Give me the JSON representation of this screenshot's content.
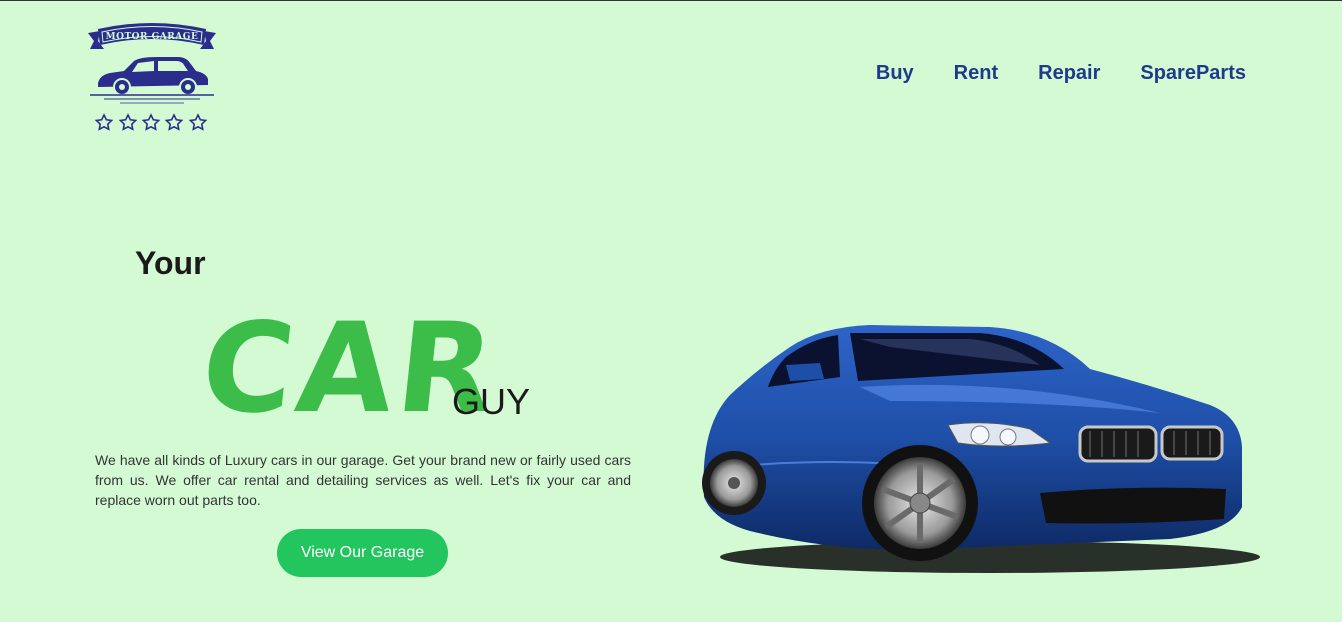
{
  "logo": {
    "text": "MOTOR GARAGE",
    "star_count": 5,
    "color": "#2b2d8c"
  },
  "nav": {
    "items": [
      "Buy",
      "Rent",
      "Repair",
      "SpareParts"
    ],
    "color": "#1f3a8a"
  },
  "hero": {
    "line1": "Your",
    "big_word": "CAR",
    "small_word": "GUY",
    "description": "We have all kinds of Luxury cars in our garage. Get your brand new or fairly used cars from us. We offer car rental and detailing services as well. Let's fix your car and replace worn out parts too.",
    "cta_label": "View Our Garage"
  },
  "colors": {
    "background": "#d4fad4",
    "accent_green": "#3cbd4a",
    "button": "#22c55e",
    "car_body": "#1e4fa8"
  },
  "images": {
    "car": "blue-sports-coupe-image"
  }
}
